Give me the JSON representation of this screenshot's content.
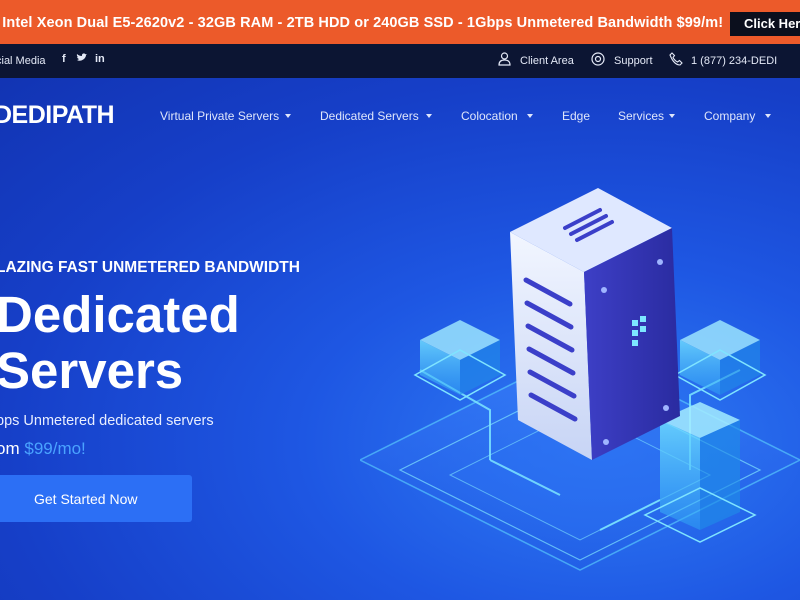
{
  "promo": {
    "text": "l Intel Xeon Dual E5-2620v2 - 32GB RAM - 2TB HDD or 240GB SSD - 1Gbps Unmetered Bandwidth $99/m!",
    "button": "Click Here"
  },
  "utility": {
    "social_label": "cial Media",
    "client_area": "Client Area",
    "support": "Support",
    "phone": "1 (877) 234-DEDI"
  },
  "header": {
    "logo": "DEDIPATH",
    "nav": [
      "Virtual Private Servers",
      "Dedicated Servers",
      "Colocation",
      "Edge",
      "Services",
      "Company"
    ]
  },
  "hero": {
    "eyebrow": "LAZING FAST UNMETERED BANDWIDTH",
    "title_line1": "Dedicated",
    "title_line2": "Servers",
    "subtitle": "bps Unmetered dedicated servers",
    "price_prefix": "om",
    "price": "$99/mo!",
    "cta": "Get Started Now"
  },
  "icons": {
    "social": [
      "facebook-icon",
      "twitter-icon",
      "linkedin-icon"
    ],
    "user": "user-icon",
    "support": "lifebuoy-icon",
    "phone": "phone-icon"
  },
  "colors": {
    "promo_bg": "#ec5a2a",
    "utility_bg": "#0c1533",
    "hero_bg": "#1546d6",
    "cta_bg": "#2c6ff5",
    "price_accent": "#4aa3ff"
  }
}
